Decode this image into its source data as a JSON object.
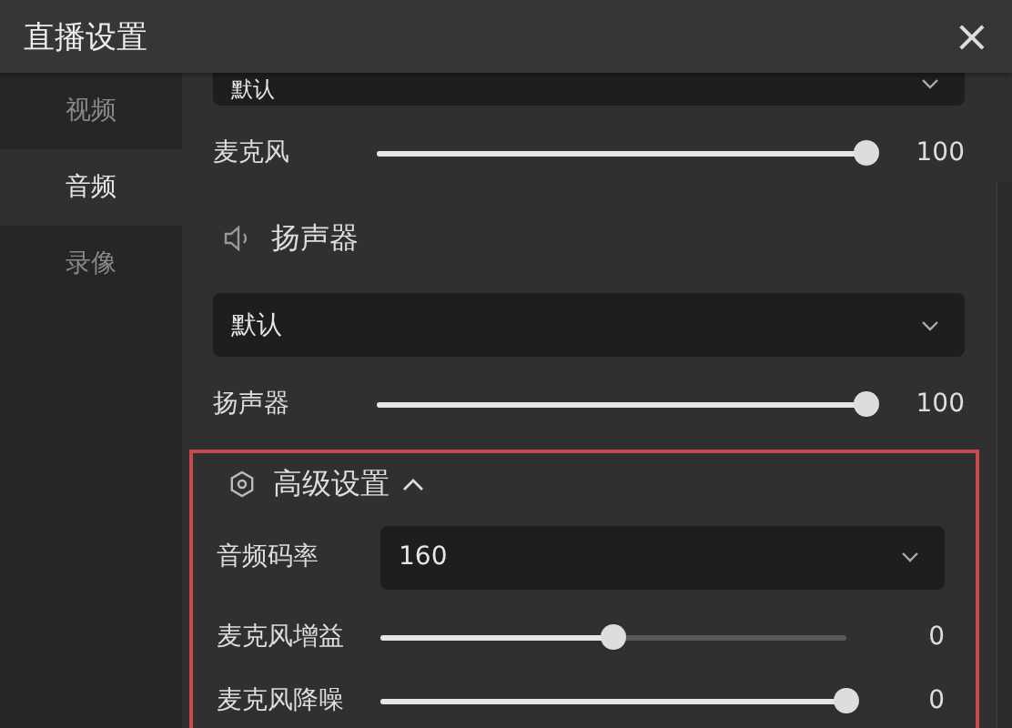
{
  "window": {
    "title": "直播设置",
    "close": "×"
  },
  "sidebar": {
    "items": [
      {
        "label": "视频",
        "selected": false
      },
      {
        "label": "音频",
        "selected": true
      },
      {
        "label": "录像",
        "selected": false
      }
    ]
  },
  "mic_device": {
    "value": "默认"
  },
  "mic": {
    "label": "麦克风",
    "level": 1.0,
    "reading": "100"
  },
  "speaker_section": {
    "title": "扬声器"
  },
  "speaker_device": {
    "value": "默认"
  },
  "speaker": {
    "label": "扬声器",
    "level": 1.0,
    "reading": "100"
  },
  "advanced": {
    "title": "高级设置",
    "expanded": true,
    "highlighted": true,
    "rows": [
      {
        "kind": "select",
        "label": "音频码率",
        "value": "160"
      },
      {
        "kind": "slider",
        "label": "麦克风增益",
        "level": 0.5,
        "reading": "0"
      },
      {
        "kind": "slider",
        "label": "麦克风降噪",
        "level": 1.0,
        "reading": "0"
      }
    ]
  }
}
